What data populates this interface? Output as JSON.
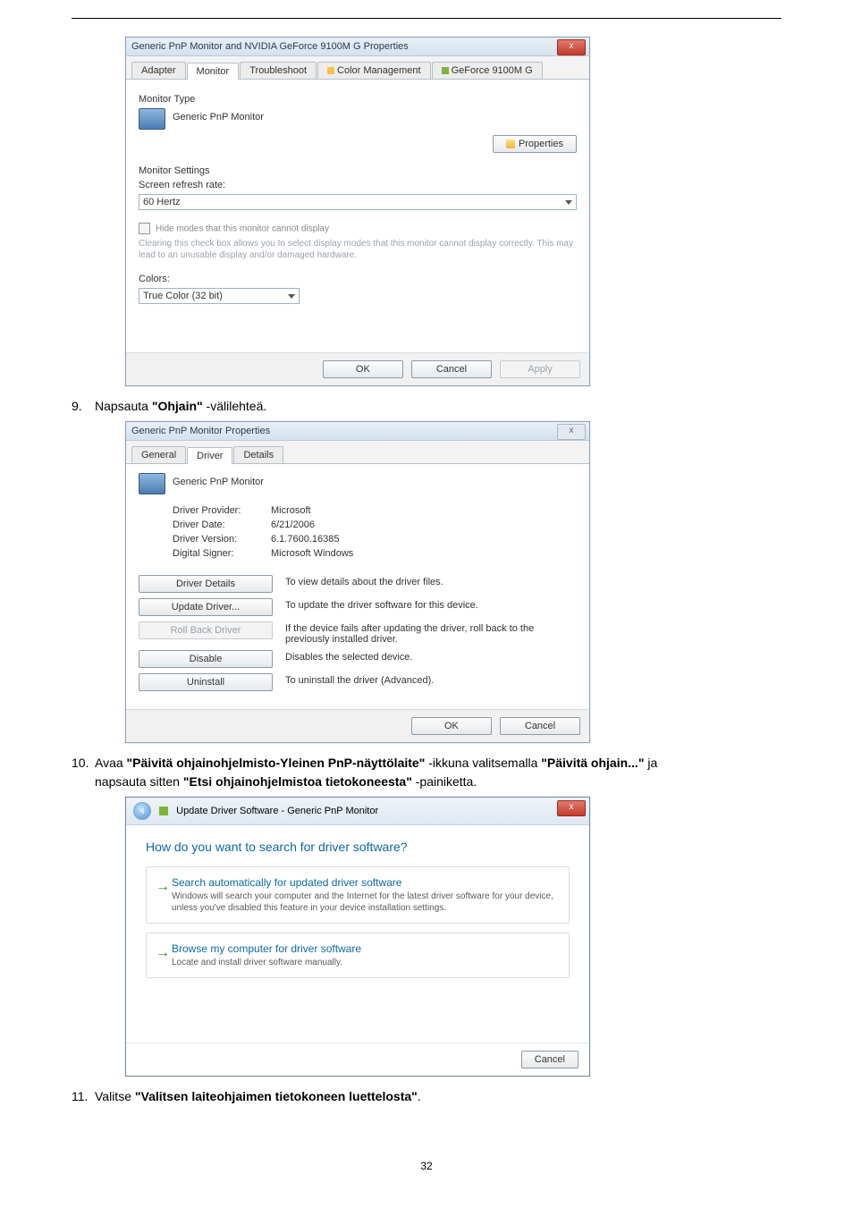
{
  "step9": {
    "num": "9.",
    "text_a": "Napsauta ",
    "bold": "\"Ohjain\"",
    "text_b": " -välilehteä."
  },
  "step10": {
    "num": "10.",
    "text_a": "Avaa ",
    "bold1": "\"Päivitä ohjainohjelmisto-Yleinen PnP-näyttölaite\"",
    "text_b": " -ikkuna valitsemalla ",
    "bold2": "\"Päivitä ohjain...\"",
    "text_c": " ja",
    "line2_a": "napsauta sitten ",
    "line2_bold": "\"Etsi ohjainohjelmistoa tietokoneesta\"",
    "line2_b": " -painiketta."
  },
  "step11": {
    "num": "11.",
    "text_a": "Valitse ",
    "bold": "\"Valitsen laiteohjaimen tietokoneen luettelosta\"",
    "text_b": "."
  },
  "dlg1": {
    "title": "Generic PnP Monitor and NVIDIA GeForce 9100M G   Properties",
    "close": "x",
    "tabs": {
      "adapter": "Adapter",
      "monitor": "Monitor",
      "troubleshoot": "Troubleshoot",
      "color": "Color Management",
      "geforce": "GeForce 9100M G"
    },
    "monitor_type_label": "Monitor Type",
    "monitor_name": "Generic PnP Monitor",
    "properties_btn": "Properties",
    "monitor_settings_label": "Monitor Settings",
    "refresh_label": "Screen refresh rate:",
    "refresh_value": "60 Hertz",
    "hide_modes": "Hide modes that this monitor cannot display",
    "hide_desc": "Clearing this check box allows you to select display modes that this monitor cannot display correctly. This may lead to an unusable display and/or damaged hardware.",
    "colors_label": "Colors:",
    "colors_value": "True Color (32 bit)",
    "ok": "OK",
    "cancel": "Cancel",
    "apply": "Apply"
  },
  "dlg2": {
    "title": "Generic PnP Monitor Properties",
    "close": "x",
    "tabs": {
      "general": "General",
      "driver": "Driver",
      "details": "Details"
    },
    "monitor_name": "Generic PnP Monitor",
    "rows": {
      "provider_k": "Driver Provider:",
      "provider_v": "Microsoft",
      "date_k": "Driver Date:",
      "date_v": "6/21/2006",
      "version_k": "Driver Version:",
      "version_v": "6.1.7600.16385",
      "signer_k": "Digital Signer:",
      "signer_v": "Microsoft Windows"
    },
    "btns": {
      "details": "Driver Details",
      "details_desc": "To view details about the driver files.",
      "update": "Update Driver...",
      "update_desc": "To update the driver software for this device.",
      "rollback": "Roll Back Driver",
      "rollback_desc": "If the device fails after updating the driver, roll back to the previously installed driver.",
      "disable": "Disable",
      "disable_desc": "Disables the selected device.",
      "uninstall": "Uninstall",
      "uninstall_desc": "To uninstall the driver (Advanced)."
    },
    "ok": "OK",
    "cancel": "Cancel"
  },
  "dlg3": {
    "title": "Update Driver Software - Generic PnP Monitor",
    "close": "x",
    "heading": "How do you want to search for driver software?",
    "opt1_title": "Search automatically for updated driver software",
    "opt1_desc": "Windows will search your computer and the Internet for the latest driver software for your device, unless you've disabled this feature in your device installation settings.",
    "opt2_title": "Browse my computer for driver software",
    "opt2_desc": "Locate and install driver software manually.",
    "cancel": "Cancel"
  },
  "page_number": "32"
}
